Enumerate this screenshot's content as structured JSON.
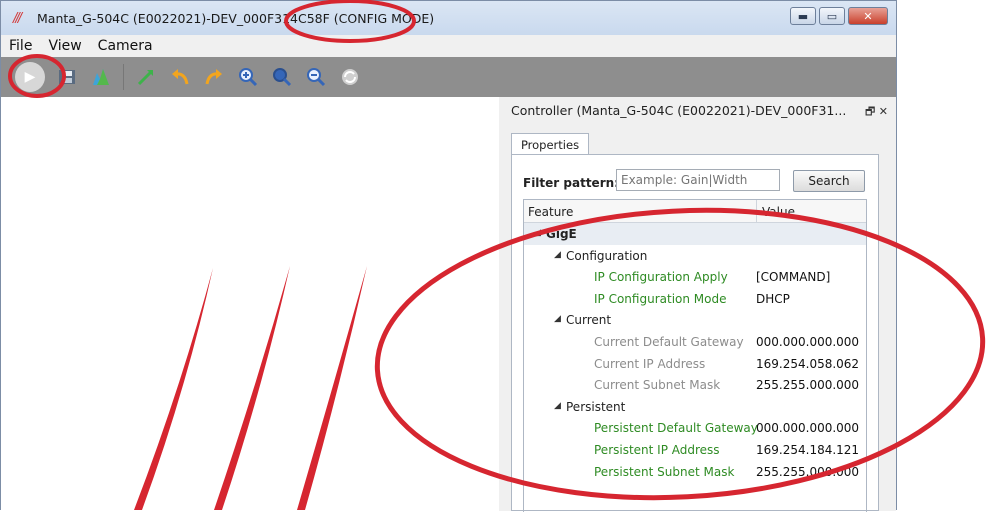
{
  "window": {
    "title": "Manta_G-504C (E0022021)-DEV_000F314C58F (CONFIG MODE)",
    "logo": "///",
    "buttons": {
      "minimize": "▬",
      "maximize": "▭",
      "close": "✕"
    }
  },
  "menu": {
    "items": [
      "File",
      "View",
      "Camera"
    ]
  },
  "toolbar": {
    "icons": [
      "play-icon",
      "save-icon",
      "histogram-icon",
      "fit-icon",
      "rotate-left-icon",
      "rotate-right-icon",
      "zoom-in-icon",
      "zoom-fit-icon",
      "zoom-out-icon",
      "refresh-icon"
    ]
  },
  "controller": {
    "title": "Controller  (Manta_G-504C (E0022021)-DEV_000F31...",
    "header_icons": "🗗 ✕",
    "tab": "Properties",
    "filter": {
      "label": "Filter pattern:",
      "placeholder": "Example: Gain|Width"
    },
    "search_label": "Search",
    "columns": {
      "feature": "Feature",
      "value": "Value"
    },
    "tree": [
      {
        "level": 0,
        "label": "GigE",
        "value": "",
        "style": "bold"
      },
      {
        "level": 1,
        "label": "Configuration",
        "value": "",
        "style": "plain"
      },
      {
        "level": 2,
        "label": "IP Configuration Apply",
        "value": "[COMMAND]",
        "style": "green"
      },
      {
        "level": 2,
        "label": "IP Configuration Mode",
        "value": "DHCP",
        "style": "green"
      },
      {
        "level": 1,
        "label": "Current",
        "value": "",
        "style": "plain"
      },
      {
        "level": 2,
        "label": "Current Default Gateway",
        "value": "000.000.000.000",
        "style": "grey"
      },
      {
        "level": 2,
        "label": "Current IP Address",
        "value": "169.254.058.062",
        "style": "grey"
      },
      {
        "level": 2,
        "label": "Current Subnet Mask",
        "value": "255.255.000.000",
        "style": "grey"
      },
      {
        "level": 1,
        "label": "Persistent",
        "value": "",
        "style": "plain"
      },
      {
        "level": 2,
        "label": "Persistent Default Gateway",
        "value": "000.000.000.000",
        "style": "green"
      },
      {
        "level": 2,
        "label": "Persistent IP Address",
        "value": "169.254.184.121",
        "style": "green"
      },
      {
        "level": 2,
        "label": "Persistent Subnet Mask",
        "value": "255.255.000.000",
        "style": "green"
      }
    ]
  },
  "colors": {
    "annotation": "#d62630",
    "feature_green": "#2e8b23",
    "toolbar_bg": "#8e8e8e"
  }
}
